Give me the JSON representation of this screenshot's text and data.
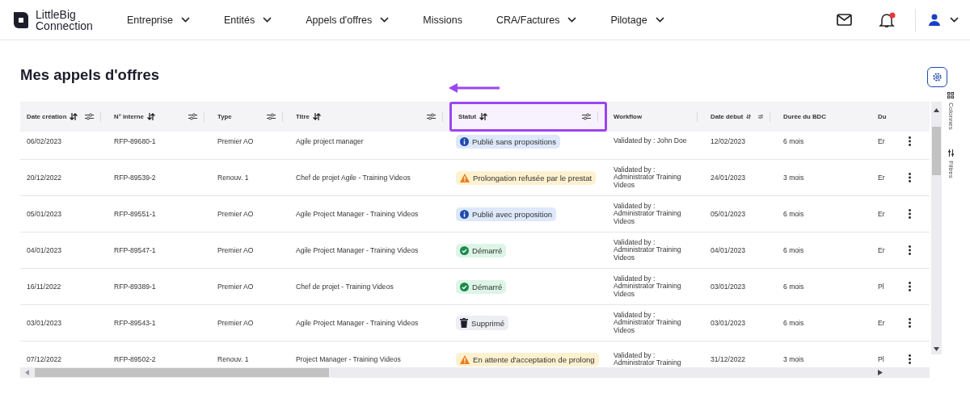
{
  "brand": {
    "line1": "LittleBig",
    "line2": "Connection"
  },
  "nav": [
    {
      "label": "Entreprise",
      "has_menu": true
    },
    {
      "label": "Entités",
      "has_menu": true
    },
    {
      "label": "Appels d'offres",
      "has_menu": true
    },
    {
      "label": "Missions",
      "has_menu": false
    },
    {
      "label": "CRA/Factures",
      "has_menu": true
    },
    {
      "label": "Pilotage",
      "has_menu": true
    }
  ],
  "notifications": {
    "unread": true
  },
  "page_title": "Mes appels d'offres",
  "table": {
    "columns": [
      {
        "label": "Date création",
        "sortable": true,
        "filterable": true,
        "highlighted": false
      },
      {
        "label": "N° interne",
        "sortable": true,
        "filterable": true,
        "highlighted": false
      },
      {
        "label": "Type",
        "sortable": false,
        "filterable": true,
        "highlighted": false
      },
      {
        "label": "Titre",
        "sortable": true,
        "filterable": true,
        "highlighted": false
      },
      {
        "label": "Statut",
        "sortable": true,
        "filterable": true,
        "highlighted": true
      },
      {
        "label": "Workflow",
        "sortable": false,
        "filterable": false,
        "highlighted": false
      },
      {
        "label": "Date début",
        "sortable": true,
        "filterable": true,
        "highlighted": false
      },
      {
        "label": "Durée du BDC",
        "sortable": false,
        "filterable": false,
        "highlighted": false
      },
      {
        "label": "Du",
        "highlighted": false
      }
    ],
    "rows": [
      {
        "created": "06/02/2023",
        "ref": "RFP-89680-1",
        "type": "Premier AO",
        "title": "Agile project manager",
        "status": {
          "label": "Publié sans propositions",
          "kind": "info"
        },
        "workflow": "Validated by : John Doe",
        "start": "12/02/2023",
        "duration": "6 mois",
        "column_9": "Er"
      },
      {
        "created": "20/12/2022",
        "ref": "RFP-89539-2",
        "type": "Renouv. 1",
        "title": "Chef de projet Agile - Training Videos",
        "status": {
          "label": "Prolongation refusée par le prestat",
          "kind": "warning"
        },
        "workflow": "Validated by : Administrator Training Videos",
        "start": "24/01/2023",
        "duration": "3 mois",
        "column_9": "Er"
      },
      {
        "created": "05/01/2023",
        "ref": "RFP-89551-1",
        "type": "Premier AO",
        "title": "Agile Project Manager - Training Videos",
        "status": {
          "label": "Publié avec proposition",
          "kind": "info"
        },
        "workflow": "Validated by : Administrator Training Videos",
        "start": "05/01/2023",
        "duration": "6 mois",
        "column_9": "Er"
      },
      {
        "created": "04/01/2023",
        "ref": "RFP-89547-1",
        "type": "Premier AO",
        "title": "Agile Project Manager - Training Videos",
        "status": {
          "label": "Démarré",
          "kind": "success"
        },
        "workflow": "Validated by : Administrator Training Videos",
        "start": "04/01/2023",
        "duration": "6 mois",
        "column_9": "Er"
      },
      {
        "created": "16/11/2022",
        "ref": "RFP-89389-1",
        "type": "Premier AO",
        "title": "Chef de projet - Training Videos",
        "status": {
          "label": "Démarré",
          "kind": "success"
        },
        "workflow": "Validated by : Administrator Training Videos",
        "start": "03/01/2023",
        "duration": "6 mois",
        "column_9": "Pl"
      },
      {
        "created": "03/01/2023",
        "ref": "RFP-89543-1",
        "type": "Premier AO",
        "title": "Agile Project Manager - Training Videos",
        "status": {
          "label": "Supprimé",
          "kind": "deleted"
        },
        "workflow": "Validated by : Administrator Training Videos",
        "start": "03/01/2023",
        "duration": "6 mois",
        "column_9": "Er"
      },
      {
        "created": "07/12/2022",
        "ref": "RFP-89502-2",
        "type": "Renouv. 1",
        "title": "Project Manager - Training Videos",
        "status": {
          "label": "En attente d'acceptation de prolong",
          "kind": "warning"
        },
        "workflow": "Validated by : Administrator Training",
        "start": "31/12/2022",
        "duration": "3 mois",
        "column_9": "Pl"
      }
    ]
  },
  "side_panel": [
    {
      "label": "Colonnes",
      "kind": "columns"
    },
    {
      "label": "Filtres",
      "kind": "filters"
    }
  ]
}
